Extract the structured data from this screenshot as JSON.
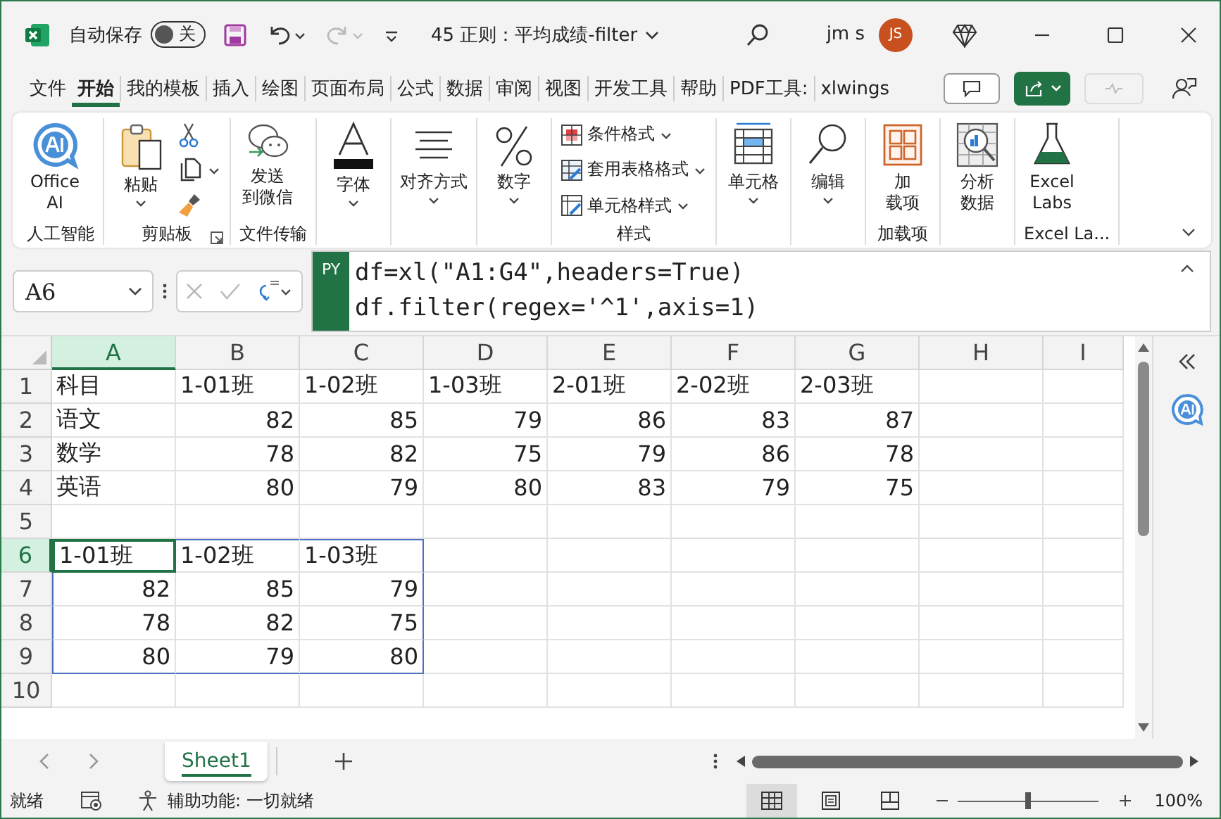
{
  "title_bar": {
    "autosave_label": "自动保存",
    "autosave": {
      "on": false,
      "label": "关"
    },
    "redo_disabled": true,
    "document_title": "45 正则：平均成绩-filter",
    "user_name": "jm s",
    "avatar": "JS"
  },
  "menu_tabs": [
    {
      "label": "文件",
      "selected": false
    },
    {
      "label": "开始",
      "selected": true
    },
    {
      "label": "我的模板",
      "selected": false
    },
    {
      "label": "插入",
      "selected": false
    },
    {
      "label": "绘图",
      "selected": false
    },
    {
      "label": "页面布局",
      "selected": false
    },
    {
      "label": "公式",
      "selected": false
    },
    {
      "label": "数据",
      "selected": false
    },
    {
      "label": "审阅",
      "selected": false
    },
    {
      "label": "视图",
      "selected": false
    },
    {
      "label": "开发工具",
      "selected": false
    },
    {
      "label": "帮助",
      "selected": false
    },
    {
      "label": "PDF工具:",
      "selected": false
    },
    {
      "label": "xlwings",
      "selected": false
    }
  ],
  "ribbon": {
    "groups": [
      {
        "label": "人工智能",
        "buttons": [
          {
            "kind": "ai",
            "lines": [
              "Office",
              "AI"
            ],
            "dropdown": false
          }
        ]
      },
      {
        "label": "剪贴板",
        "launcher": true,
        "buttons": [
          {
            "kind": "paste",
            "lines": [
              "粘贴"
            ],
            "dropdown": true
          },
          {
            "kind": "cut",
            "dropdown": false
          },
          {
            "kind": "copy",
            "dropdown": true
          },
          {
            "kind": "brush",
            "dropdown": false
          }
        ]
      },
      {
        "label": "文件传输",
        "buttons": [
          {
            "kind": "wechat",
            "lines": [
              "发送",
              "到微信"
            ],
            "dropdown": false
          }
        ]
      },
      {
        "buttons": [
          {
            "kind": "font",
            "lines": [
              "字体"
            ],
            "dropdown": true
          }
        ]
      },
      {
        "buttons": [
          {
            "kind": "align",
            "lines": [
              "对齐方式"
            ],
            "dropdown": true
          }
        ]
      },
      {
        "buttons": [
          {
            "kind": "number",
            "lines": [
              "数字"
            ],
            "dropdown": true
          }
        ]
      },
      {
        "label": "样式",
        "buttons": [
          {
            "kind": "condfmt",
            "lines": [
              "条件格式"
            ],
            "dropdown": true
          },
          {
            "kind": "tablefmt",
            "lines": [
              "套用表格格式"
            ],
            "dropdown": true
          },
          {
            "kind": "cellstyle",
            "lines": [
              "单元格样式"
            ],
            "dropdown": true
          }
        ]
      },
      {
        "buttons": [
          {
            "kind": "cells",
            "lines": [
              "单元格"
            ],
            "dropdown": true
          }
        ]
      },
      {
        "buttons": [
          {
            "kind": "find",
            "lines": [
              "编辑"
            ],
            "dropdown": true
          }
        ]
      },
      {
        "label": "加载项",
        "buttons": [
          {
            "kind": "addins",
            "lines": [
              "加",
              "载项"
            ],
            "dropdown": false
          }
        ]
      },
      {
        "buttons": [
          {
            "kind": "analyze",
            "lines": [
              "分析",
              "数据"
            ],
            "dropdown": false
          }
        ]
      },
      {
        "label": "Excel La...",
        "buttons": [
          {
            "kind": "labs",
            "lines": [
              "Excel",
              "Labs"
            ],
            "dropdown": false
          }
        ]
      }
    ]
  },
  "formula_bar": {
    "name_box": "A6",
    "badge": "PY",
    "lines": [
      "df=xl(\"A1:G4\",headers=True)",
      "df.filter(regex='^1',axis=1)"
    ]
  },
  "grid": {
    "columns": [
      {
        "label": "A",
        "selected": true
      },
      {
        "label": "B",
        "selected": false
      },
      {
        "label": "C",
        "selected": false
      },
      {
        "label": "D",
        "selected": false
      },
      {
        "label": "E",
        "selected": false
      },
      {
        "label": "F",
        "selected": false
      },
      {
        "label": "G",
        "selected": false
      },
      {
        "label": "H",
        "selected": false
      },
      {
        "label": "I",
        "selected": false
      }
    ],
    "rows": [
      {
        "header": "1",
        "selected": false,
        "kind": "header",
        "cells": [
          {
            "text": "科目",
            "selected": false
          },
          {
            "text": "1-01班",
            "selected": false
          },
          {
            "text": "1-02班",
            "selected": false
          },
          {
            "text": "1-03班",
            "selected": false
          },
          {
            "text": "2-01班",
            "selected": false
          },
          {
            "text": "2-02班",
            "selected": false
          },
          {
            "text": "2-03班",
            "selected": false
          }
        ]
      },
      {
        "header": "2",
        "selected": false,
        "kind": "data",
        "cells": [
          {
            "text": "语文",
            "selected": false
          },
          {
            "text": "82",
            "selected": false
          },
          {
            "text": "85",
            "selected": false
          },
          {
            "text": "79",
            "selected": false
          },
          {
            "text": "86",
            "selected": false
          },
          {
            "text": "83",
            "selected": false
          },
          {
            "text": "87",
            "selected": false
          }
        ]
      },
      {
        "header": "3",
        "selected": false,
        "kind": "data",
        "cells": [
          {
            "text": "数学",
            "selected": false
          },
          {
            "text": "78",
            "selected": false
          },
          {
            "text": "82",
            "selected": false
          },
          {
            "text": "75",
            "selected": false
          },
          {
            "text": "79",
            "selected": false
          },
          {
            "text": "86",
            "selected": false
          },
          {
            "text": "78",
            "selected": false
          }
        ]
      },
      {
        "header": "4",
        "selected": false,
        "kind": "data",
        "cells": [
          {
            "text": "英语",
            "selected": false
          },
          {
            "text": "80",
            "selected": false
          },
          {
            "text": "79",
            "selected": false
          },
          {
            "text": "80",
            "selected": false
          },
          {
            "text": "83",
            "selected": false
          },
          {
            "text": "79",
            "selected": false
          },
          {
            "text": "75",
            "selected": false
          }
        ]
      },
      {
        "header": "5",
        "selected": false
      },
      {
        "header": "6",
        "selected": true,
        "kind": "header",
        "spill": true,
        "cells": [
          {
            "text": "1-01班",
            "selected": true
          },
          {
            "text": "1-02班",
            "selected": false
          },
          {
            "text": "1-03班",
            "selected": false
          }
        ]
      },
      {
        "header": "7",
        "selected": false,
        "kind": "values",
        "spill": true,
        "cells": [
          {
            "text": "82",
            "selected": false
          },
          {
            "text": "85",
            "selected": false
          },
          {
            "text": "79",
            "selected": false
          }
        ]
      },
      {
        "header": "8",
        "selected": false,
        "kind": "values",
        "spill": true,
        "cells": [
          {
            "text": "78",
            "selected": false
          },
          {
            "text": "82",
            "selected": false
          },
          {
            "text": "75",
            "selected": false
          }
        ]
      },
      {
        "header": "9",
        "selected": false,
        "kind": "values",
        "spill": true,
        "cells": [
          {
            "text": "80",
            "selected": false
          },
          {
            "text": "79",
            "selected": false
          },
          {
            "text": "80",
            "selected": false
          }
        ]
      },
      {
        "header": "10",
        "selected": false
      }
    ]
  },
  "sheet_tabs": [
    {
      "label": "Sheet1",
      "selected": true
    }
  ],
  "status_bar": {
    "ready": "就绪",
    "accessibility": "辅助功能: 一切就绪",
    "views": [
      {
        "kind": "normal",
        "selected": true
      },
      {
        "kind": "page",
        "selected": false
      },
      {
        "kind": "break",
        "selected": false
      }
    ],
    "zoom": {
      "level": 0.5,
      "reading": "100%"
    }
  }
}
